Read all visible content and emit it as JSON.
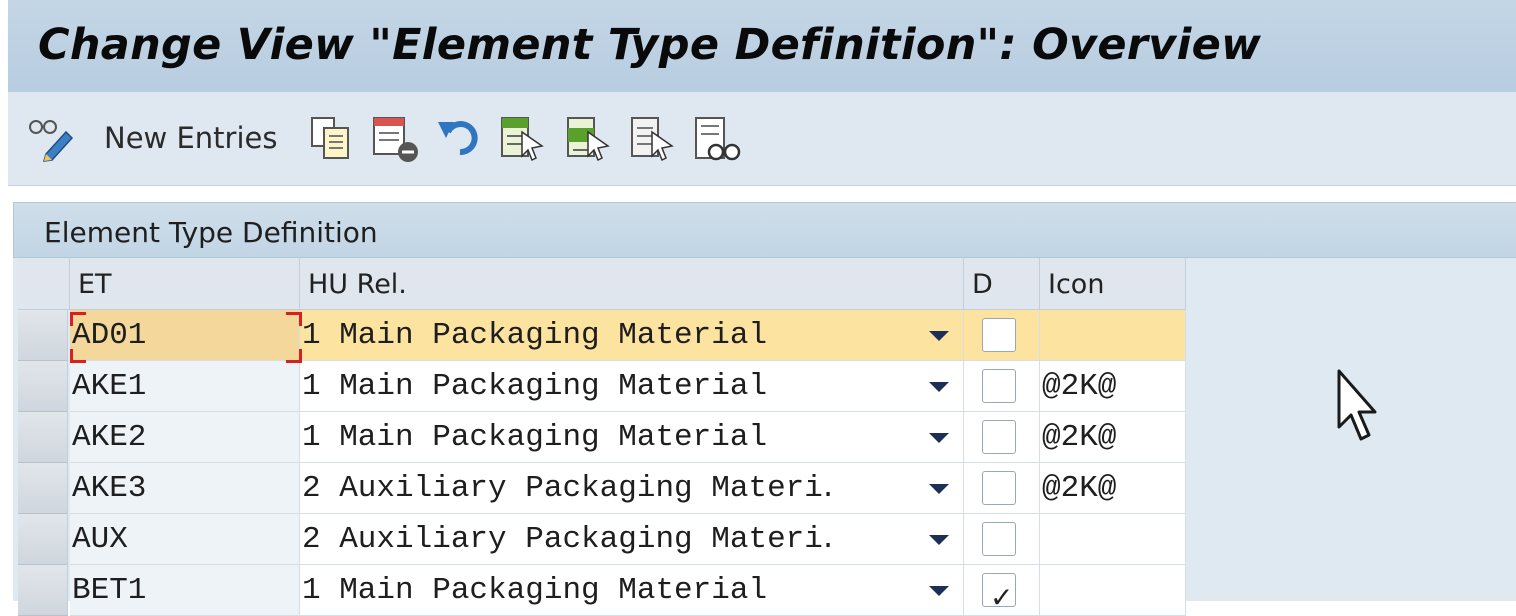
{
  "window": {
    "title": "Change View \"Element Type Definition\": Overview"
  },
  "toolbar": {
    "new_entries_label": "New Entries",
    "icons": [
      "display-change-glasses-icon",
      "copy-as-icon",
      "delete-icon",
      "undo-change-icon",
      "select-all-icon",
      "select-block-icon",
      "deselect-all-icon",
      "choose-display-icon"
    ]
  },
  "panel": {
    "title": "Element Type Definition"
  },
  "table": {
    "headers": {
      "et": "ET",
      "hu_rel": "HU Rel.",
      "d": "D",
      "icon": "Icon"
    },
    "rows": [
      {
        "et": "AD01",
        "hu_rel": "1 Main Packaging Material",
        "d": false,
        "icon": "",
        "selected": true
      },
      {
        "et": "AKE1",
        "hu_rel": "1 Main Packaging Material",
        "d": false,
        "icon": "@2K@"
      },
      {
        "et": "AKE2",
        "hu_rel": "1 Main Packaging Material",
        "d": false,
        "icon": "@2K@"
      },
      {
        "et": "AKE3",
        "hu_rel": "2 Auxiliary Packaging Materi․",
        "d": false,
        "icon": "@2K@"
      },
      {
        "et": "AUX",
        "hu_rel": "2 Auxiliary Packaging Materi․",
        "d": false,
        "icon": ""
      },
      {
        "et": "BET1",
        "hu_rel": "1 Main Packaging Material",
        "d": true,
        "icon": ""
      }
    ],
    "checkmark_glyph": "✓"
  },
  "colors": {
    "title_bar": "#c4d6e6",
    "toolbar": "#dfe8f1",
    "selected_row": "#fde3a0",
    "dropdown_arrow": "#1d2f55"
  }
}
